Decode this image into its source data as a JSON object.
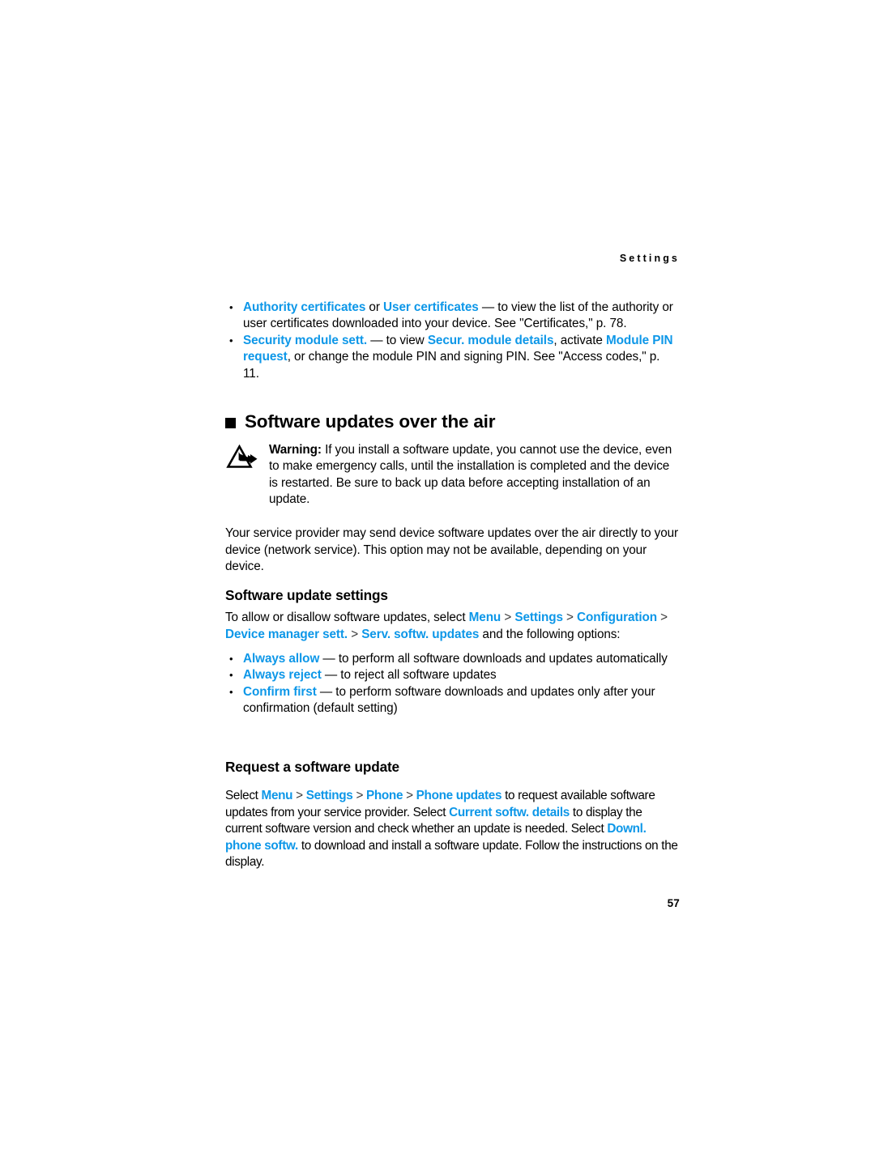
{
  "document": {
    "running_head": "Settings",
    "page_number": "57"
  },
  "intro_bullets": [
    {
      "id": "certificates",
      "segments": [
        {
          "text": "Authority certificates",
          "style": "ui"
        },
        {
          "text": " or ",
          "style": "plain"
        },
        {
          "text": "User certificates",
          "style": "ui"
        },
        {
          "text": " — to view the list of the authority or user certificates downloaded into your device. See \"Certificates,\" p. 78.",
          "style": "plain"
        }
      ],
      "plain_text": "Authority certificates or User certificates — to view the list of the authority or user certificates downloaded into your device. See \"Certificates,\" p. 78."
    },
    {
      "id": "security-module-sett",
      "segments": [
        {
          "text": "Security module sett.",
          "style": "ui"
        },
        {
          "text": " — to view ",
          "style": "plain"
        },
        {
          "text": "Secur. module details",
          "style": "ui"
        },
        {
          "text": ", activate ",
          "style": "plain"
        },
        {
          "text": "Module PIN request",
          "style": "ui"
        },
        {
          "text": ", or change the module PIN and signing PIN. See \"Access codes,\" p. 11.",
          "style": "plain"
        }
      ],
      "plain_text": "Security module sett. — to view Secur. module details, activate Module PIN request, or change the module PIN and signing PIN. See \"Access codes,\" p. 11."
    }
  ],
  "section": {
    "title": "Software updates over the air",
    "bullet_icon": "filled-square-icon"
  },
  "warning": {
    "icon": "warning-triangle-arrow-icon",
    "label": "Warning:",
    "body": " If you install a software update, you cannot use the device, even to make emergency calls, until the installation is completed and the device is restarted. Be sure to back up data before accepting installation of an update."
  },
  "paragraphs": {
    "provider": "Your service provider may send device software updates over the air directly to your device (network service). This option may not be available, depending on your device.",
    "allow_intro_pre": "To allow or disallow software updates, select ",
    "allow_intro_post": " and the following options:"
  },
  "subheadings": {
    "software_update_settings": "Software update settings",
    "request_a_software_update": "Request a software update"
  },
  "menu_path_settings": [
    {
      "label": "Menu",
      "style": "ui"
    },
    {
      "label": ">",
      "style": "sep"
    },
    {
      "label": "Settings",
      "style": "ui"
    },
    {
      "label": ">",
      "style": "sep"
    },
    {
      "label": "Configuration",
      "style": "ui"
    },
    {
      "label": ">",
      "style": "sep"
    },
    {
      "label": "Device manager sett.",
      "style": "ui"
    },
    {
      "label": ">",
      "style": "sep"
    },
    {
      "label": "Serv. softw. updates",
      "style": "ui"
    }
  ],
  "option_bullets": [
    {
      "id": "always-allow",
      "term": "Always allow",
      "description": " — to perform all software downloads and updates automatically"
    },
    {
      "id": "always-reject",
      "term": "Always reject",
      "description": " — to reject all software updates"
    },
    {
      "id": "confirm-first",
      "term": "Confirm first",
      "description": " — to perform software downloads and updates only after your confirmation (default setting)"
    }
  ],
  "request_paragraph": {
    "lead": "Select ",
    "path": [
      {
        "label": "Menu",
        "style": "ui"
      },
      {
        "label": ">",
        "style": "sep"
      },
      {
        "label": "Settings",
        "style": "ui"
      },
      {
        "label": ">",
        "style": "sep"
      },
      {
        "label": "Phone",
        "style": "ui"
      },
      {
        "label": ">",
        "style": "sep"
      },
      {
        "label": "Phone updates",
        "style": "ui"
      }
    ],
    "mid1": " to request available software updates from your service provider. Select ",
    "link1": "Current softw. details",
    "mid2": " to display the current software version and check whether an update is needed. Select ",
    "link2": "Downl. phone softw.",
    "mid3": " to download and install a software update. Follow the instructions on the display."
  },
  "colors": {
    "ui_blue": "#0d97e8",
    "text_black": "#000000",
    "separator_gray": "#3a3a3a",
    "page_background": "#ffffff"
  }
}
